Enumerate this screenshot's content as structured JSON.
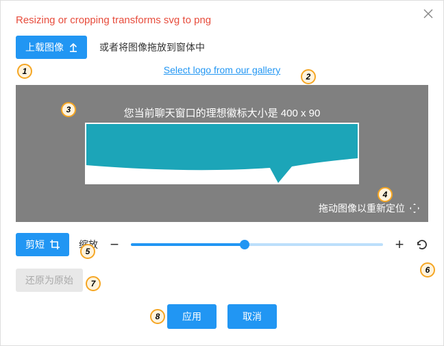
{
  "warning": "Resizing or cropping transforms svg to png",
  "upload": {
    "button": "上载图像",
    "drag_text": "或者将图像拖放到窗体中"
  },
  "gallery": {
    "link": "Select logo from our gallery"
  },
  "preview": {
    "ideal_size": "您当前聊天窗口的理想徽标大小是 400 x 90",
    "reposition": "拖动图像以重新定位"
  },
  "crop": {
    "button": "剪短"
  },
  "zoom": {
    "label": "缩放"
  },
  "restore": {
    "button": "还原为原始"
  },
  "actions": {
    "apply": "应用",
    "cancel": "取消"
  },
  "markers": {
    "m1": "1",
    "m2": "2",
    "m3": "3",
    "m4": "4",
    "m5": "5",
    "m6": "6",
    "m7": "7",
    "m8": "8"
  },
  "colors": {
    "primary": "#2196f3",
    "warning": "#e74c3c",
    "logo": "#1ca5b8"
  }
}
